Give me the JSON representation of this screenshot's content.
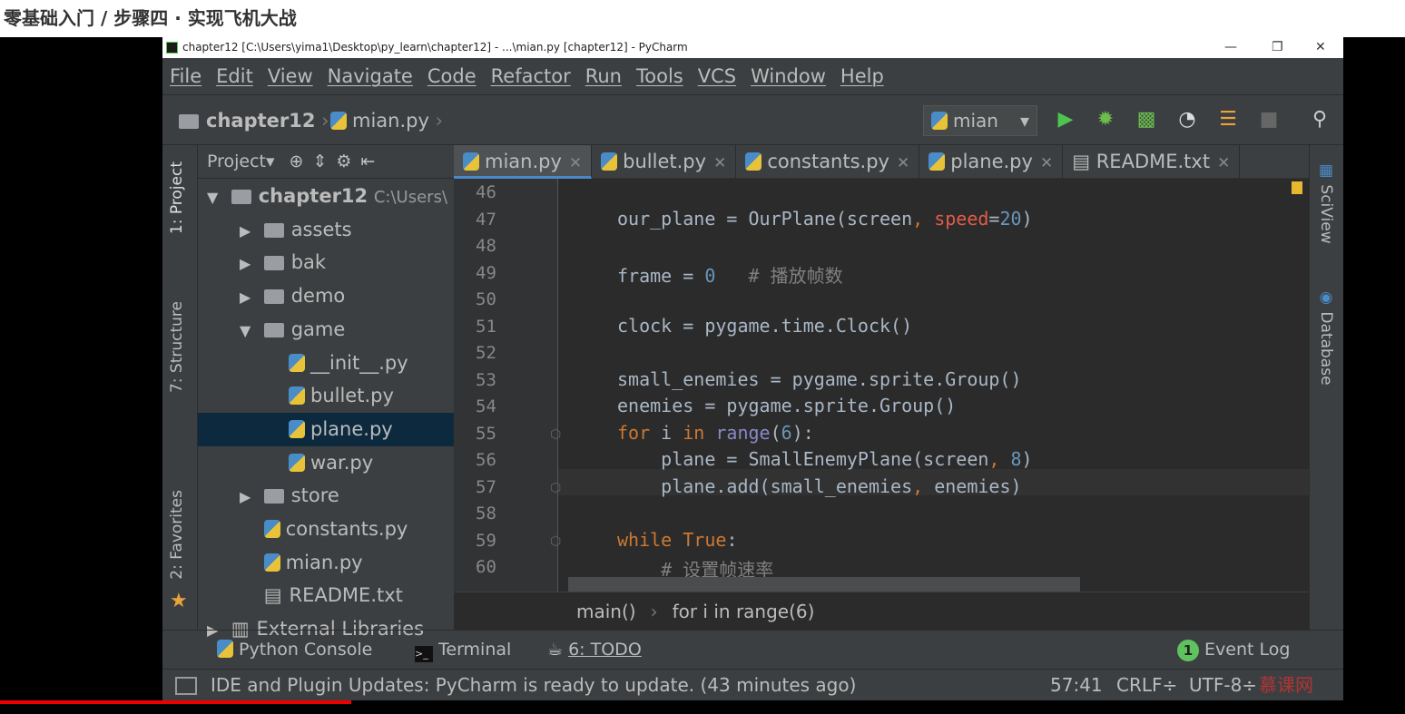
{
  "page_header": "零基础入门 / 步骤四 · 实现飞机大战",
  "window": {
    "title": "chapter12 [C:\\Users\\yima1\\Desktop\\py_learn\\chapter12] - ...\\mian.py [chapter12] - PyCharm"
  },
  "menu": [
    "File",
    "Edit",
    "View",
    "Navigate",
    "Code",
    "Refactor",
    "Run",
    "Tools",
    "VCS",
    "Window",
    "Help"
  ],
  "nav": {
    "project": "chapter12",
    "file": "mian.py",
    "run_config": "mian"
  },
  "toolbar_icons": [
    "run-icon",
    "debug-icon",
    "coverage-icon",
    "profile-icon",
    "concurrency-icon",
    "stop-icon",
    "search-icon"
  ],
  "left_tabs": [
    "1: Project",
    "7: Structure",
    "2: Favorites"
  ],
  "right_tabs": [
    "SciView",
    "Database"
  ],
  "project": {
    "header": "Project▾",
    "tree": [
      {
        "label": "chapter12",
        "extra": "C:\\Users\\",
        "type": "folder",
        "open": true,
        "depth": 0
      },
      {
        "label": "assets",
        "type": "folder",
        "depth": 1
      },
      {
        "label": "bak",
        "type": "folder",
        "depth": 1
      },
      {
        "label": "demo",
        "type": "folder",
        "depth": 1
      },
      {
        "label": "game",
        "type": "folder",
        "open": true,
        "depth": 1
      },
      {
        "label": "__init__.py",
        "type": "py",
        "depth": 2
      },
      {
        "label": "bullet.py",
        "type": "py",
        "depth": 2
      },
      {
        "label": "plane.py",
        "type": "py",
        "depth": 2,
        "selected": true
      },
      {
        "label": "war.py",
        "type": "py",
        "depth": 2
      },
      {
        "label": "store",
        "type": "folder",
        "depth": 1
      },
      {
        "label": "constants.py",
        "type": "py",
        "depth": 1
      },
      {
        "label": "mian.py",
        "type": "py",
        "depth": 1
      },
      {
        "label": "README.txt",
        "type": "txt",
        "depth": 1
      },
      {
        "label": "External Libraries",
        "type": "lib",
        "depth": 0
      }
    ]
  },
  "tabs": [
    {
      "label": "mian.py",
      "active": true
    },
    {
      "label": "bullet.py"
    },
    {
      "label": "constants.py"
    },
    {
      "label": "plane.py"
    },
    {
      "label": "README.txt"
    }
  ],
  "code": {
    "lines": [
      "46",
      "47",
      "48",
      "49",
      "50",
      "51",
      "52",
      "53",
      "54",
      "55",
      "56",
      "57",
      "58",
      "59",
      "60"
    ],
    "l47": [
      "our_plane = OurPlane(screen",
      ", ",
      "speed",
      "=",
      "20",
      ")"
    ],
    "l49": [
      "frame = ",
      "0",
      "   # 播放帧数"
    ],
    "l51": "clock = pygame.time.Clock()",
    "l53": "small_enemies = pygame.sprite.Group()",
    "l54": "enemies = pygame.sprite.Group()",
    "l55": [
      "for",
      " i ",
      "in",
      " ",
      "range",
      "(",
      "6",
      "):"
    ],
    "l56": [
      "    plane = SmallEnemyPlane(screen",
      ", ",
      "8",
      ")"
    ],
    "l57": [
      "    plane.add(small_enemies",
      ", ",
      "enemies)"
    ],
    "l59": [
      "while",
      " ",
      "True",
      ":"
    ],
    "l60": "    # 设置帧速率"
  },
  "breadcrumbs": [
    "main()",
    "for i in range(6)"
  ],
  "toolwindows": [
    "Python Console",
    "Terminal",
    "6: TODO",
    "Event Log"
  ],
  "event_count": "1",
  "status": {
    "message": "IDE and Plugin Updates: PyCharm is ready to update. (43 minutes ago)",
    "position": "57:41",
    "line_sep": "CRLF÷",
    "encoding": "UTF-8÷"
  },
  "watermark": "慕课网",
  "video_progress_percent": 25
}
